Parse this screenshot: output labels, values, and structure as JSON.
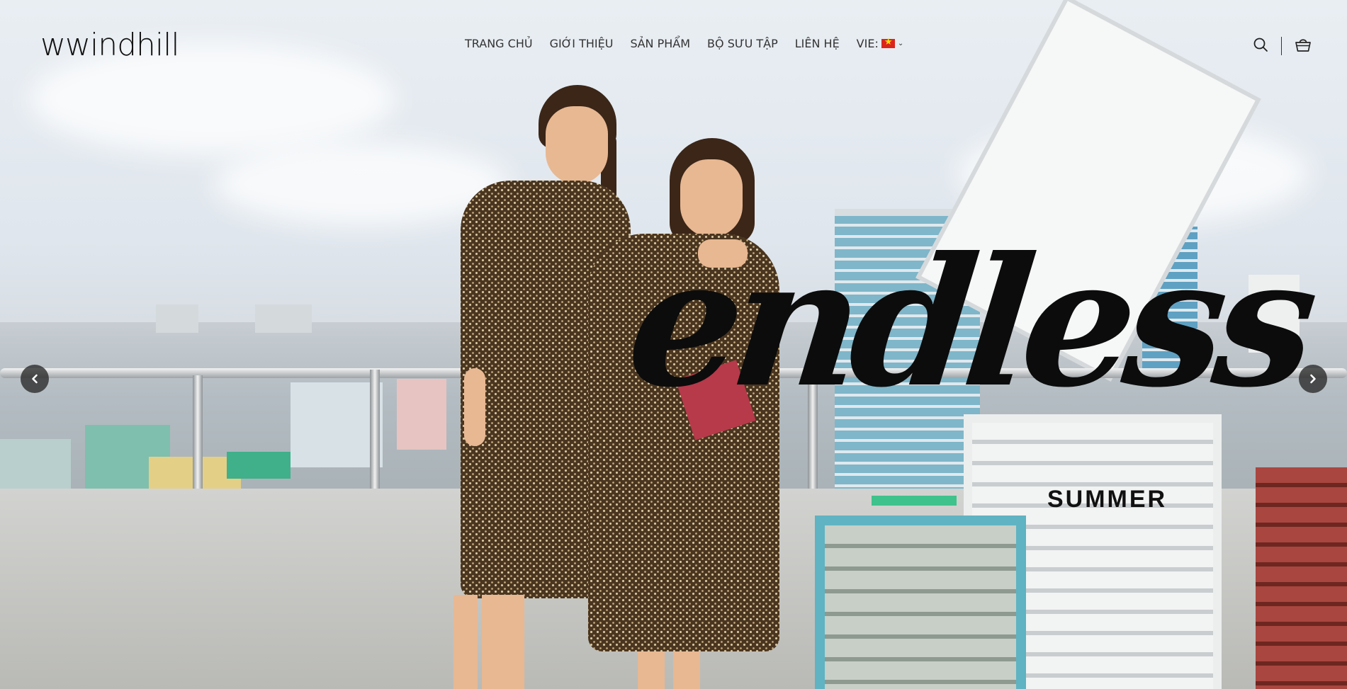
{
  "brand": {
    "logo_text": "wwindhill"
  },
  "nav": {
    "items": [
      {
        "label": "TRANG CHỦ"
      },
      {
        "label": "GIỚI THIỆU"
      },
      {
        "label": "SẢN PHẨM"
      },
      {
        "label": "BỘ SƯU TẬP"
      },
      {
        "label": "LIÊN HỆ"
      }
    ],
    "language": {
      "label": "VIE:",
      "flag": "vietnam-flag-icon",
      "dropdown_icon": "chevron-down-icon"
    }
  },
  "header_icons": {
    "search": "search-icon",
    "cart": "cart-icon"
  },
  "hero": {
    "script_text": "endless",
    "subtitle": "SUMMER"
  },
  "slider": {
    "prev_icon": "chevron-left-icon",
    "next_icon": "chevron-right-icon"
  },
  "colors": {
    "text_dark": "#111111",
    "arrow_bg": "#282828",
    "flag_red": "#da251d",
    "flag_star": "#ffde00"
  }
}
